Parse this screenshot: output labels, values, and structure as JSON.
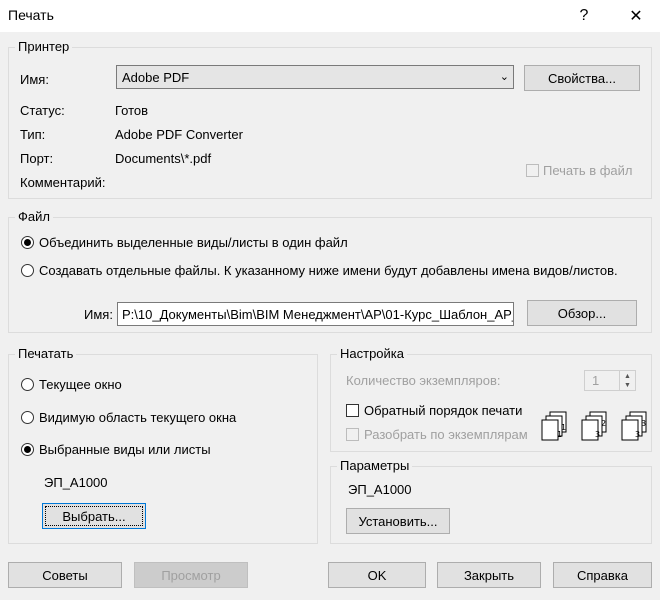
{
  "window": {
    "title": "Печать",
    "help_icon": "?",
    "close_icon": "✕"
  },
  "printer": {
    "legend": "Принтер",
    "name_label": "Имя:",
    "name_value": "Adobe PDF",
    "properties_button": "Свойства...",
    "status_label": "Статус:",
    "status_value": "Готов",
    "type_label": "Тип:",
    "type_value": "Adobe PDF Converter",
    "port_label": "Порт:",
    "port_value": "Documents\\*.pdf",
    "comment_label": "Комментарий:",
    "print_to_file": "Печать в файл"
  },
  "file": {
    "legend": "Файл",
    "combine_option": "Объединить выделенные виды/листы в один файл",
    "separate_option": "Создавать отдельные файлы. К указанному ниже имени будут добавлены имена видов/листов.",
    "name_label": "Имя:",
    "name_value": "P:\\10_Документы\\Bim\\BIM Менеджмент\\АР\\01-Курс_Шаблон_АР_",
    "browse_button": "Обзор..."
  },
  "print_range": {
    "legend": "Печатать",
    "current_window": "Текущее окно",
    "visible_area": "Видимую область текущего окна",
    "selected_views": "Выбранные виды или листы",
    "selected_set": "ЭП_А1000",
    "select_button": "Выбрать..."
  },
  "settings": {
    "legend": "Настройка",
    "copies_label": "Количество экземпляров:",
    "copies_value": "1",
    "reverse_order": "Обратный порядок печати",
    "collate": "Разобрать по экземплярам",
    "collate_icon": "collate-pages-icon"
  },
  "parameters": {
    "legend": "Параметры",
    "value": "ЭП_А1000",
    "setup_button": "Установить..."
  },
  "footer": {
    "tips_button": "Советы",
    "preview_button": "Просмотр",
    "ok_button": "OK",
    "close_button": "Закрыть",
    "help_button": "Справка"
  }
}
